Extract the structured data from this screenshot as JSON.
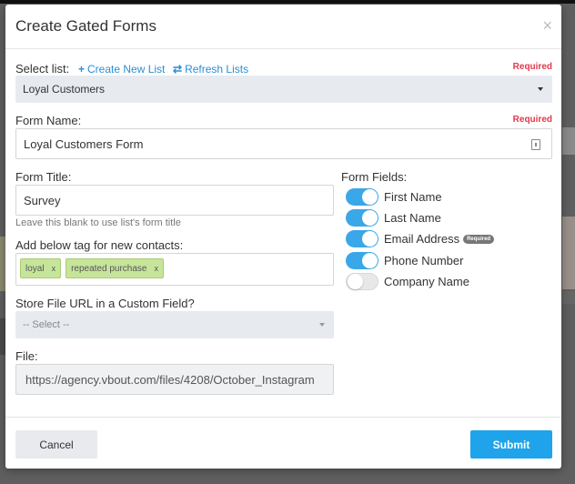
{
  "modal": {
    "title": "Create Gated Forms",
    "close_icon": "close-icon",
    "close_glyph": "×"
  },
  "select_list": {
    "label": "Select list:",
    "create_link": "Create New List",
    "create_icon": "plus-icon",
    "refresh_link": "Refresh Lists",
    "refresh_icon": "refresh-icon",
    "required": "Required",
    "value": "Loyal Customers"
  },
  "form_name": {
    "label": "Form Name:",
    "required": "Required",
    "value": "Loyal Customers Form"
  },
  "form_title": {
    "label": "Form Title:",
    "value": "Survey",
    "help": "Leave this blank to use list's form title"
  },
  "tags": {
    "label": "Add below tag for new contacts:",
    "items": [
      {
        "text": "loyal",
        "remove": "x"
      },
      {
        "text": "repeated purchase",
        "remove": "x"
      }
    ]
  },
  "custom_field": {
    "label": "Store File URL in a Custom Field?",
    "value": "-- Select --"
  },
  "file": {
    "label": "File:",
    "value": "https://agency.vbout.com/files/4208/October_Instagram"
  },
  "form_fields": {
    "label": "Form Fields:",
    "items": [
      {
        "label": "First Name",
        "on": true
      },
      {
        "label": "Last Name",
        "on": true
      },
      {
        "label": "Email Address",
        "on": true,
        "badge": "Required"
      },
      {
        "label": "Phone Number",
        "on": true
      },
      {
        "label": "Company Name",
        "on": false
      }
    ]
  },
  "footer": {
    "cancel": "Cancel",
    "submit": "Submit"
  },
  "colors": {
    "accent": "#1fa3ea",
    "toggle_on": "#3aa7e8",
    "required": "#e0394b",
    "tag_bg": "#c6e59a"
  }
}
